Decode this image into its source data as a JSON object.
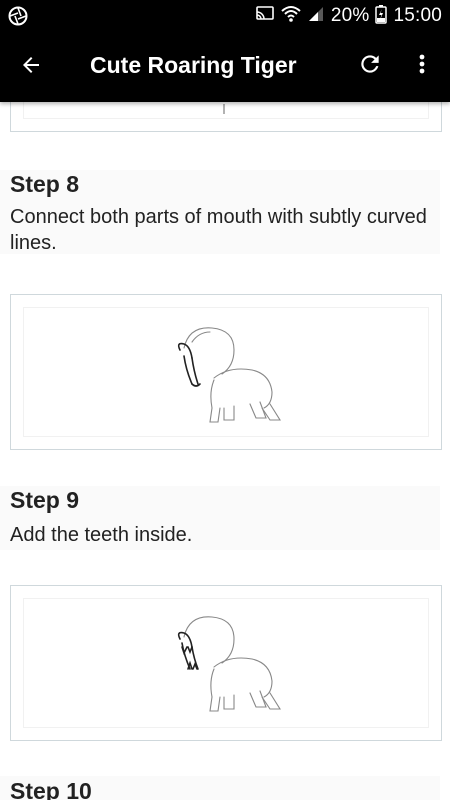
{
  "status_bar": {
    "battery_percent": "20%",
    "time": "15:00",
    "icons": [
      "aperture-icon",
      "cast-icon",
      "wifi-icon",
      "signal-icon",
      "battery-charging-icon"
    ]
  },
  "app_bar": {
    "title": "Cute Roaring Tiger",
    "icons": [
      "back-arrow-icon",
      "refresh-icon",
      "more-vert-icon"
    ]
  },
  "steps": [
    {
      "title": "Step 8",
      "description": "Connect both parts of mouth with subtly curved lines."
    },
    {
      "title": "Step 9",
      "description": "Add the teeth inside."
    },
    {
      "title": "Step 10",
      "description": ""
    }
  ]
}
